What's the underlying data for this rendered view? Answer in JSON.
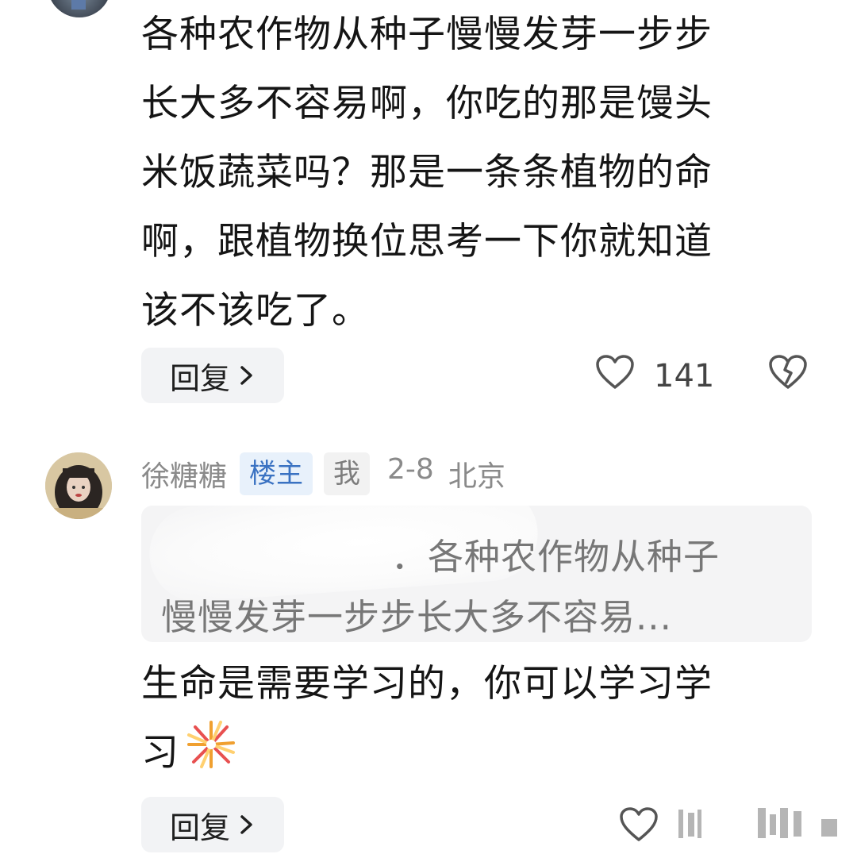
{
  "comment1": {
    "lines": [
      "各种农作物从种子慢慢发芽一步步",
      "长大多不容易啊，你吃的那是馒头",
      "米饭蔬菜吗？那是一条条植物的命",
      "啊，跟植物换位思考一下你就知道",
      "该不该吃了。"
    ],
    "reply_label": "回复",
    "like_count": "141"
  },
  "comment2": {
    "username": "徐糖糖",
    "badge_owner": "楼主",
    "badge_me": "我",
    "date": "2-8",
    "location": "北京",
    "quote_lines": [
      "．各种农作物从种子",
      "慢慢发芽一步步长大多不容易..."
    ],
    "text_lines": [
      "生命是需要学习的，你可以学习学",
      "习"
    ],
    "reply_label": "回复"
  },
  "icons": {
    "like": "heart-outline-icon",
    "dislike": "broken-heart-icon",
    "chevron": "chevron-right-icon",
    "emoji": "firework-emoji"
  }
}
